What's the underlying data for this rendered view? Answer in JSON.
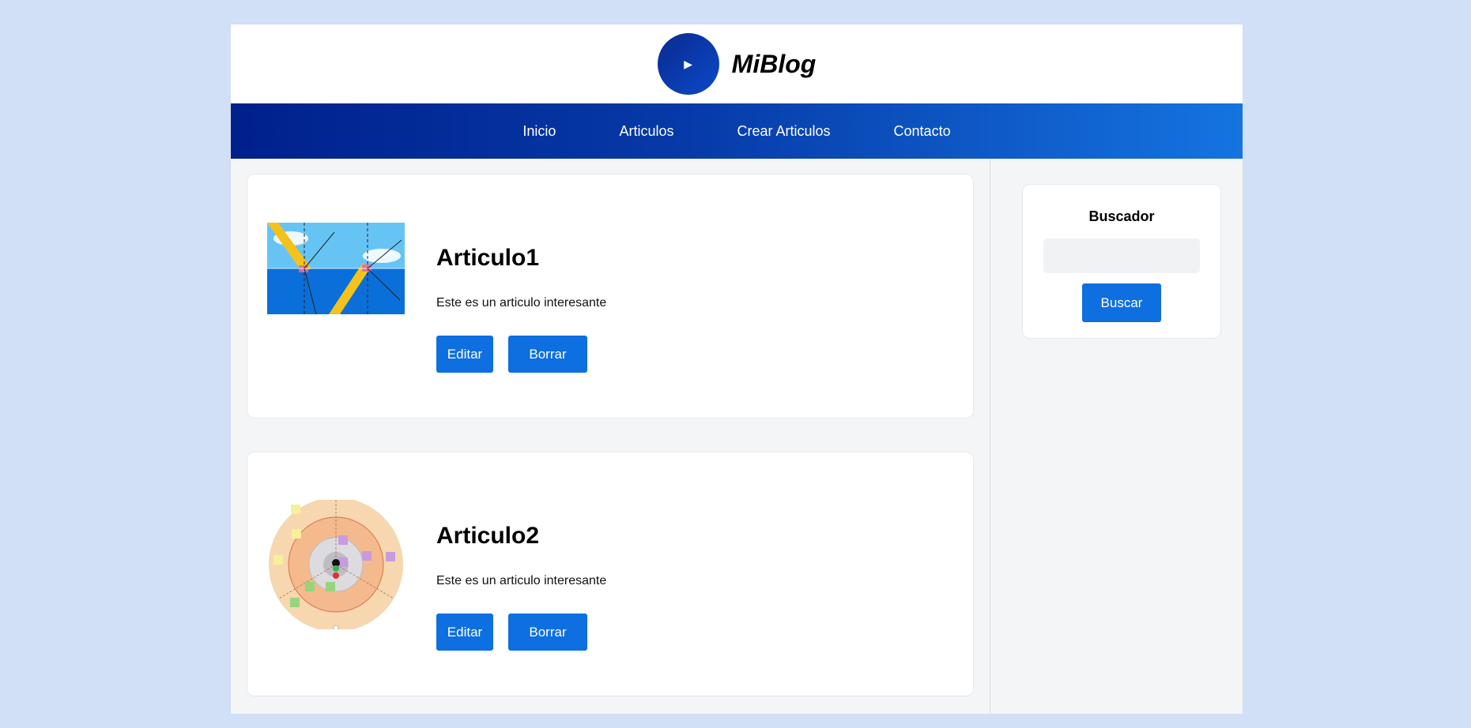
{
  "brand": {
    "name": "MiBlog",
    "logo_icon": "play-icon"
  },
  "nav": {
    "items": [
      {
        "label": "Inicio"
      },
      {
        "label": "Articulos"
      },
      {
        "label": "Crear Articulos"
      },
      {
        "label": "Contacto"
      }
    ]
  },
  "articles": [
    {
      "title": "Articulo1",
      "description": "Este es un articulo interesante",
      "edit_label": "Editar",
      "delete_label": "Borrar"
    },
    {
      "title": "Articulo2",
      "description": "Este es un articulo interesante",
      "edit_label": "Editar",
      "delete_label": "Borrar"
    }
  ],
  "sidebar": {
    "search_title": "Buscador",
    "search_value": "",
    "search_button": "Buscar"
  },
  "colors": {
    "background": "#d1dff7",
    "accent": "#0d6fe0",
    "nav_start": "#00208c",
    "nav_end": "#1574e0"
  }
}
